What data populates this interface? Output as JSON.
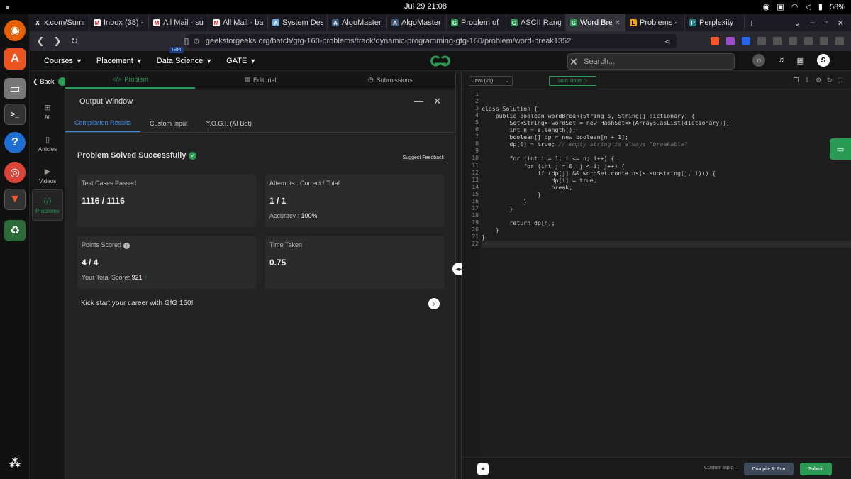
{
  "os": {
    "clock": "Jul 29  21:08",
    "battery": "58%"
  },
  "browser": {
    "tabs": [
      {
        "label": "x.com/Summ",
        "color": "#222222",
        "icon": "X"
      },
      {
        "label": "Inbox (38) - b",
        "color": "#c5221f",
        "icon": "M"
      },
      {
        "label": "All Mail - sum",
        "color": "#c5221f",
        "icon": "M"
      },
      {
        "label": "All Mail - banc",
        "color": "#c5221f",
        "icon": "M"
      },
      {
        "label": "System Desig",
        "color": "#6fa8dc",
        "icon": "A"
      },
      {
        "label": "AlgoMaster.io",
        "color": "#3d5a80",
        "icon": "A"
      },
      {
        "label": "AlgoMaster N",
        "color": "#3d5a80",
        "icon": "A"
      },
      {
        "label": "Problem of th",
        "color": "#2a9a55",
        "icon": "G"
      },
      {
        "label": "ASCII Range S",
        "color": "#2a9a55",
        "icon": "G"
      },
      {
        "label": "Word Bre",
        "color": "#2a9a55",
        "icon": "G"
      },
      {
        "label": "Problems - Le",
        "color": "#f0a500",
        "icon": "L"
      },
      {
        "label": "Perplexity",
        "color": "#20808d",
        "icon": "P"
      }
    ],
    "new_tab": "+",
    "url": "geeksforgeeks.org/batch/gfg-160-problems/track/dynamic-programming-gfg-160/problem/word-break1352"
  },
  "nav": {
    "items": [
      "Courses",
      "Placement",
      "Data Science",
      "GATE"
    ],
    "ibm_badge": "IBM",
    "logo": "GfG",
    "search_placeholder": "Search...",
    "avatar": "S"
  },
  "rail": {
    "back": "Back",
    "items": [
      "All",
      "Articles",
      "Videos",
      "Problems"
    ]
  },
  "problem_tabs": [
    "Problem",
    "Editorial",
    "Submissions"
  ],
  "output": {
    "title": "Output Window",
    "tabs": [
      "Compilation Results",
      "Custom Input",
      "Y.O.G.I. (AI Bot)"
    ],
    "status": "Problem Solved Successfully",
    "feedback": "Suggest Feedback",
    "cards": {
      "tests_label": "Test Cases Passed",
      "tests_value": "1116 / 1116",
      "attempts_label": "Attempts : Correct / Total",
      "attempts_value": "1 / 1",
      "accuracy_label": "Accuracy :",
      "accuracy_value": "100%",
      "points_label": "Points Scored",
      "points_value": "4 / 4",
      "total_label": "Your Total Score:",
      "total_value": "921",
      "time_label": "Time Taken",
      "time_value": "0.75"
    },
    "kickstart": "Kick start your career with GfG 160!"
  },
  "editor": {
    "language": "Java (21)",
    "timer": "Start Timer",
    "code": [
      "",
      "",
      "class Solution {",
      "    public boolean wordBreak(String s, String[] dictionary) {",
      "        Set<String> wordSet = new HashSet<>(Arrays.asList(dictionary));",
      "        int n = s.length();",
      "        boolean[] dp = new boolean[n + 1];",
      "        dp[0] = true; // empty string is always \"breakable\"",
      "",
      "        for (int i = 1; i <= n; i++) {",
      "            for (int j = 0; j < i; j++) {",
      "                if (dp[j] && wordSet.contains(s.substring(j, i))) {",
      "                    dp[i] = true;",
      "                    break;",
      "                }",
      "            }",
      "        }",
      "",
      "        return dp[n];",
      "    }",
      "}",
      ""
    ],
    "custom_input": "Custom Input",
    "run": "Compile & Run",
    "submit": "Submit"
  }
}
